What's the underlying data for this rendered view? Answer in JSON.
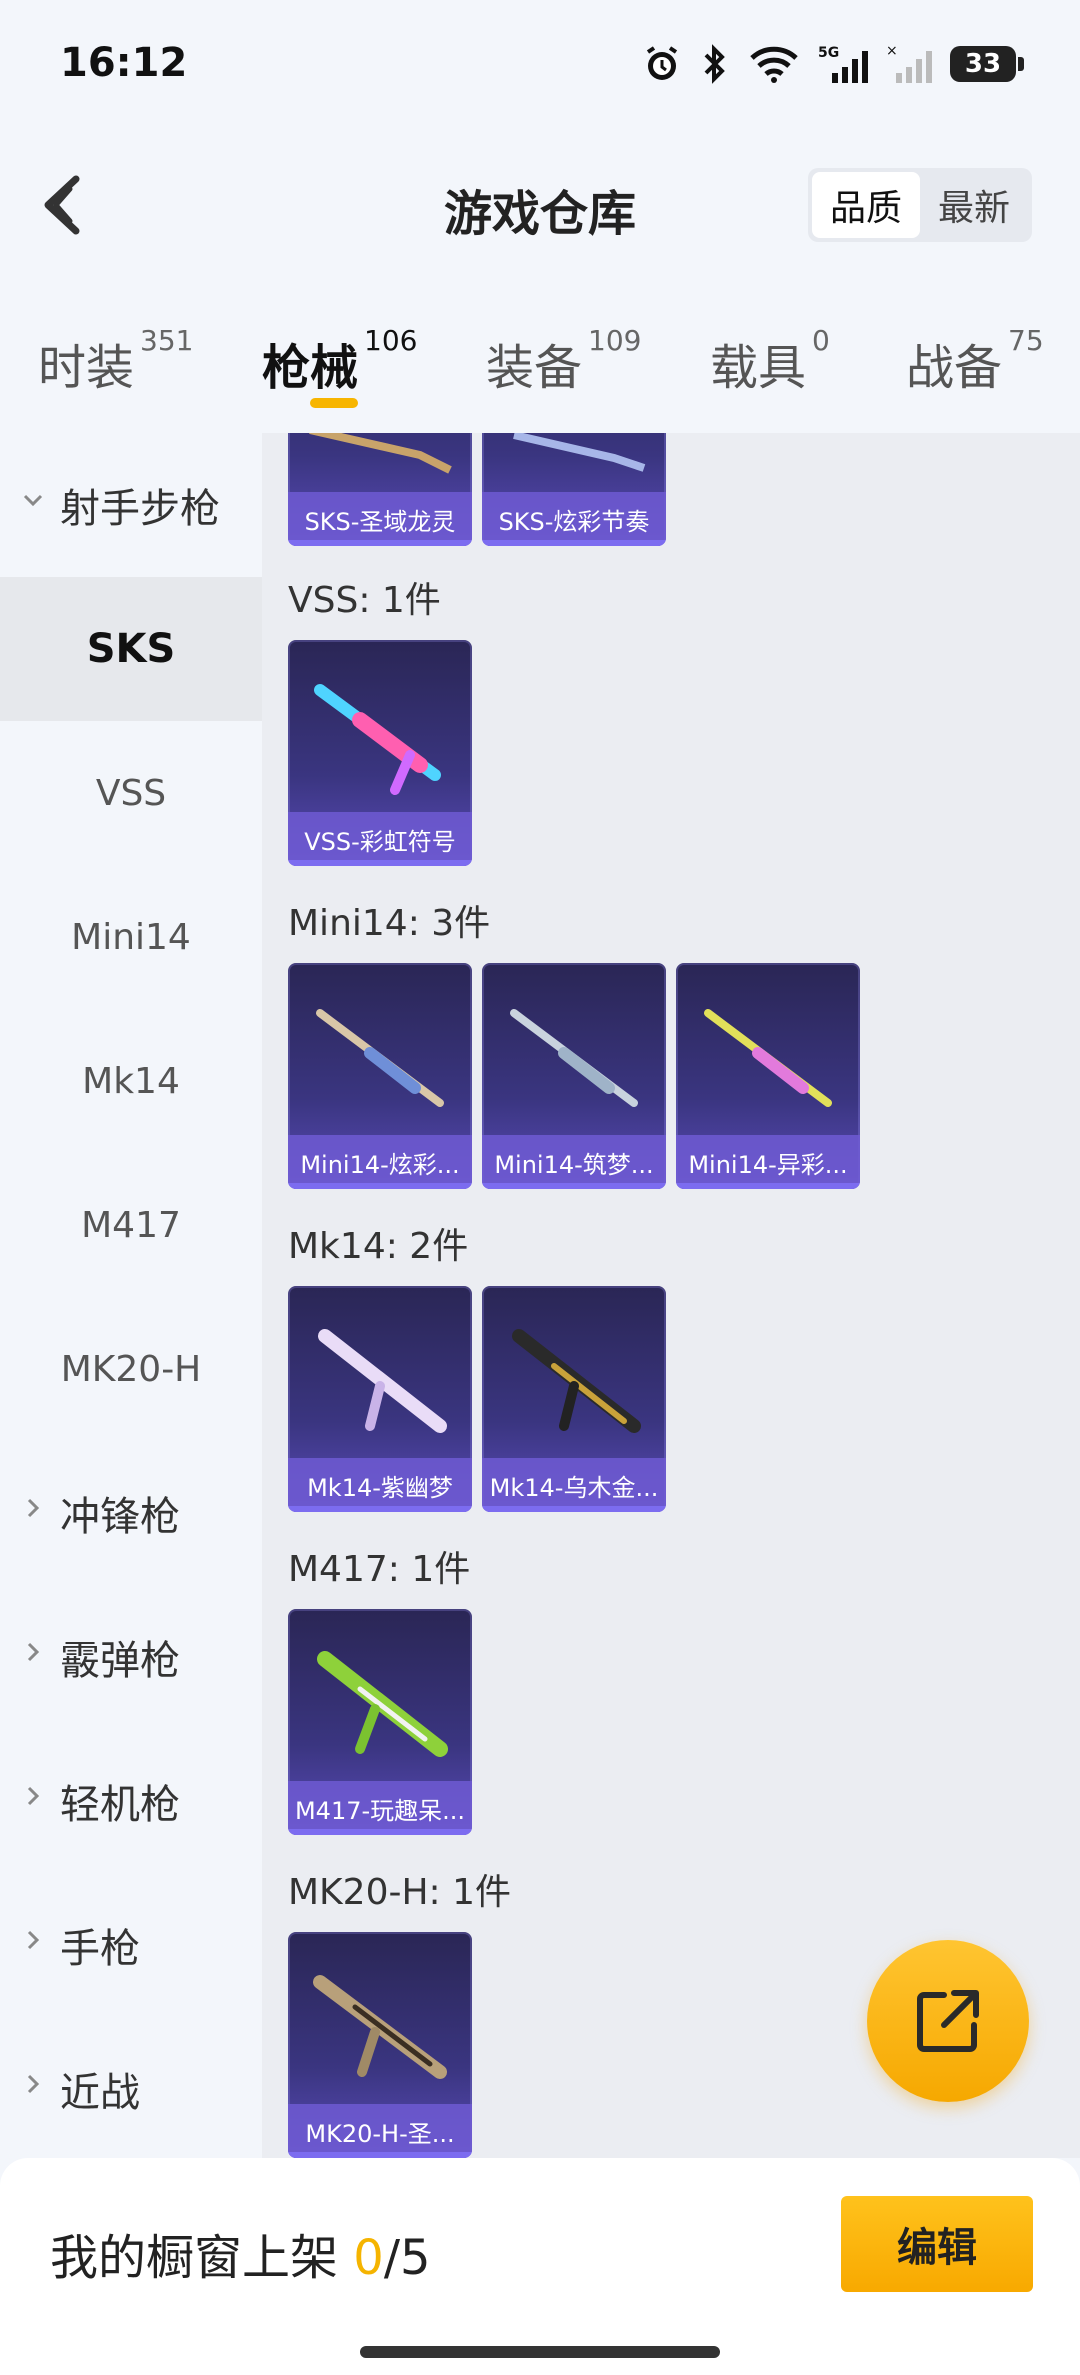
{
  "status_bar": {
    "time": "16:12",
    "battery": "33",
    "icons": [
      "alarm-icon",
      "bluetooth-icon",
      "wifi-icon",
      "signal-5g-icon",
      "signal-icon",
      "battery-icon"
    ]
  },
  "header": {
    "title": "游戏仓库",
    "sort_options": [
      "品质",
      "最新"
    ],
    "active_sort": "品质"
  },
  "tabs": [
    {
      "label": "时装",
      "count": "351"
    },
    {
      "label": "枪械",
      "count": "106",
      "active": true
    },
    {
      "label": "装备",
      "count": "109"
    },
    {
      "label": "载具",
      "count": "0"
    },
    {
      "label": "战备",
      "count": "75"
    }
  ],
  "sidebar": {
    "expanded_group": "射手步枪",
    "sub_items": [
      "SKS",
      "VSS",
      "Mini14",
      "Mk14",
      "M417",
      "MK20-H"
    ],
    "active_sub": "SKS",
    "collapsed_groups": [
      "冲锋枪",
      "霰弹枪",
      "轻机枪",
      "手枪",
      "近战"
    ]
  },
  "content": {
    "partial_row": [
      "SKS-圣域龙灵",
      "SKS-炫彩节奏"
    ],
    "groups": [
      {
        "label": "VSS: 1件",
        "items": [
          "VSS-彩虹符号"
        ]
      },
      {
        "label": "Mini14: 3件",
        "items": [
          "Mini14-炫彩...",
          "Mini14-筑梦...",
          "Mini14-异彩..."
        ]
      },
      {
        "label": "Mk14: 2件",
        "items": [
          "Mk14-紫幽梦",
          "Mk14-乌木金..."
        ]
      },
      {
        "label": "M417: 1件",
        "items": [
          "M417-玩趣呆..."
        ]
      },
      {
        "label": "MK20-H: 1件",
        "items": [
          "MK20-H-圣..."
        ]
      }
    ]
  },
  "bottom_bar": {
    "label": "我的橱窗上架",
    "current": "0",
    "separator": "/",
    "max": "5",
    "edit_button": "编辑"
  },
  "colors": {
    "accent": "#f7b500",
    "card_bg": "#3a3580",
    "caption_bg": "#6e5ad2"
  }
}
